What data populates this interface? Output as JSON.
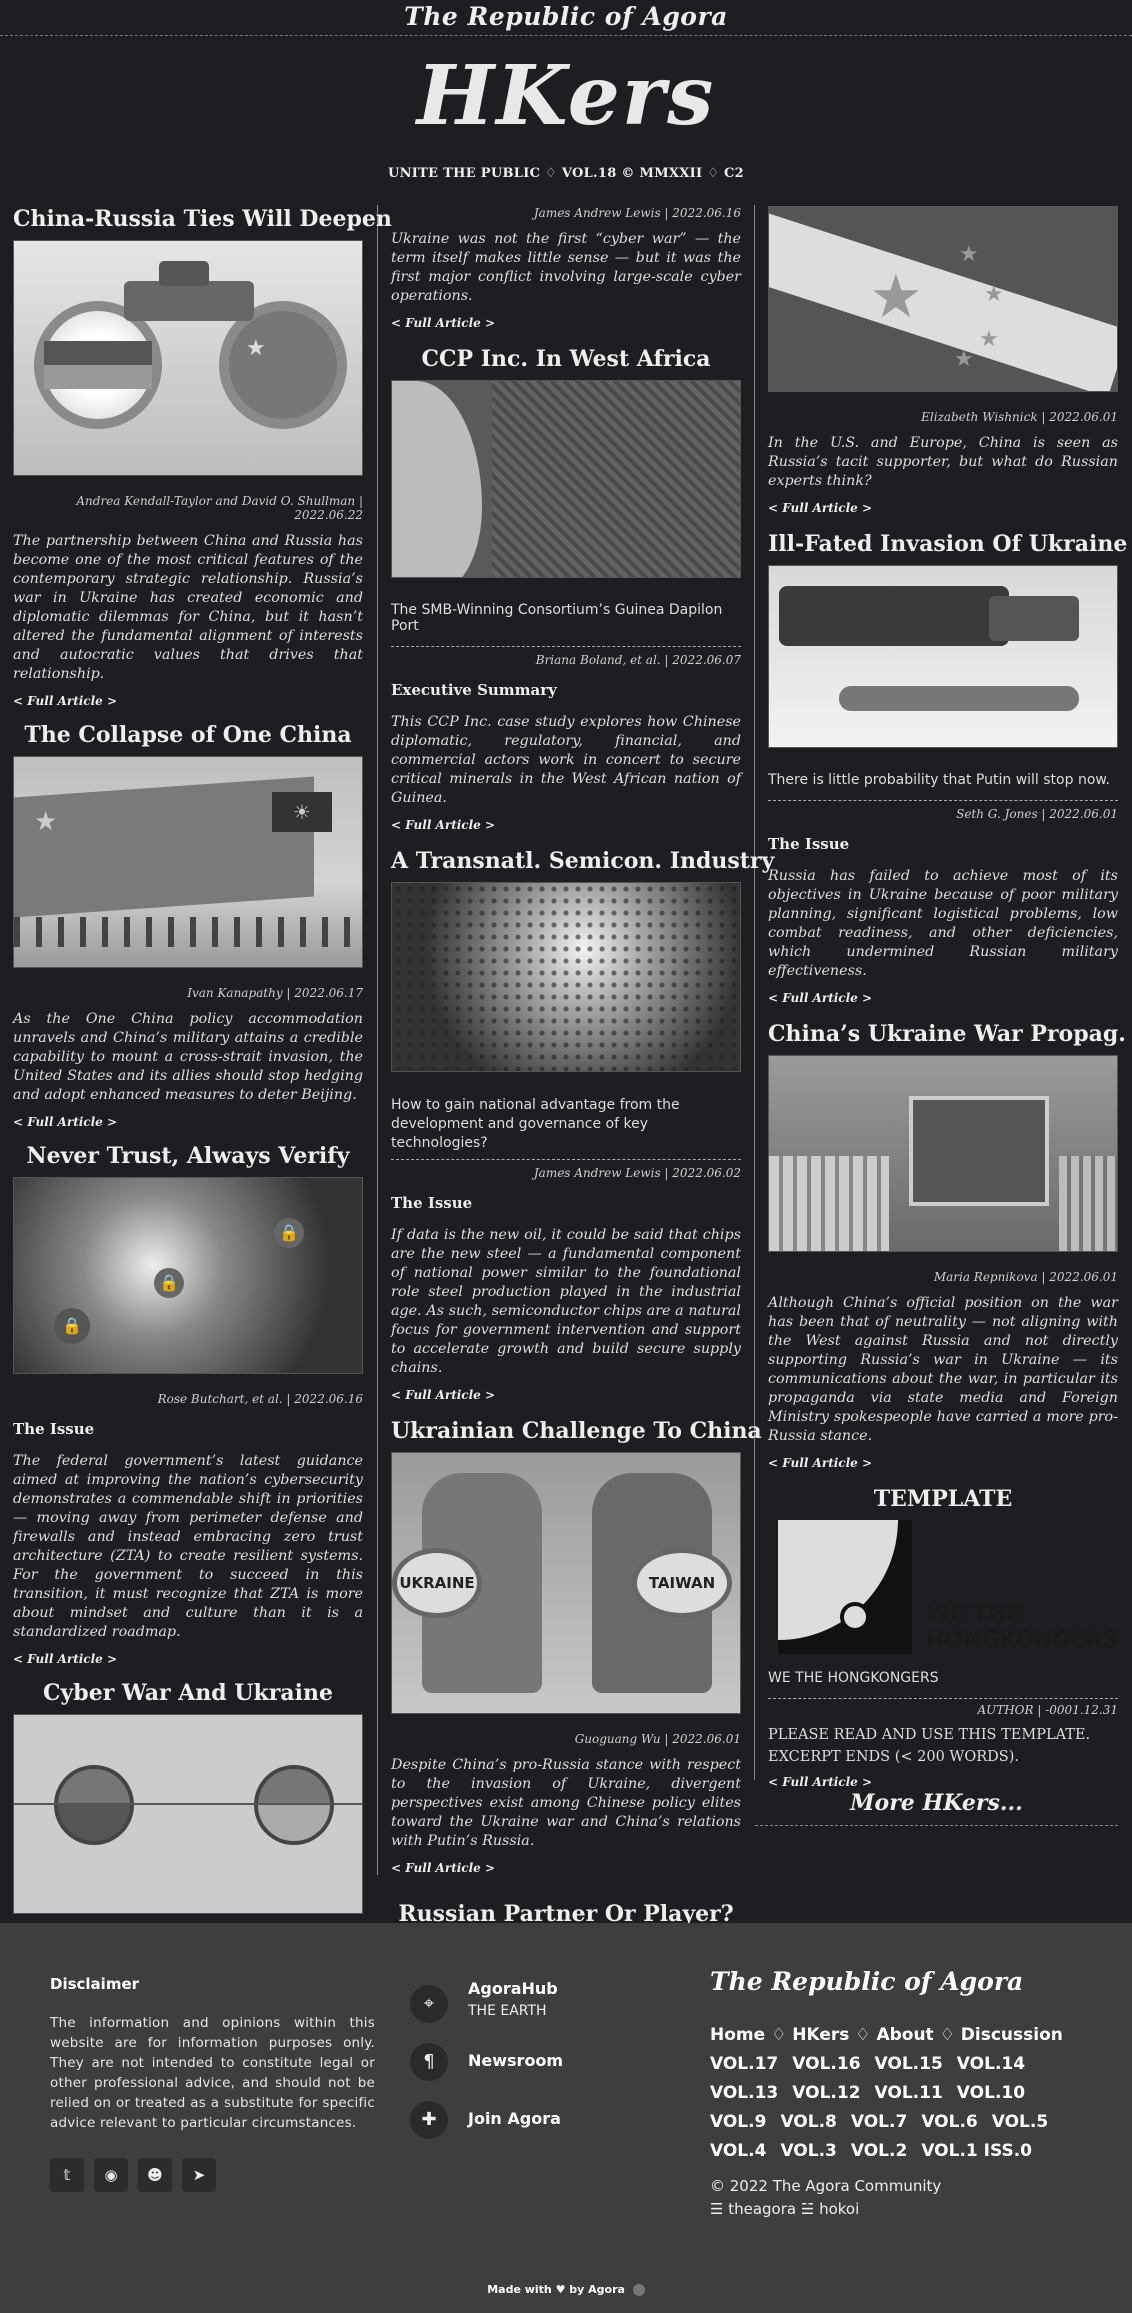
{
  "header": {
    "masthead": "The Republic of Agora",
    "logo": "HKers",
    "tagline": "UNITE THE PUBLIC ♢ VOL.18 © MMXXII ♢ C2"
  },
  "articles": {
    "a1": {
      "title": "China-Russia Ties Will Deepen",
      "byline": "Andrea Kendall-Taylor and David O. Shullman | 2022.06.22",
      "text": "The partnership between China and Russia has become one of the most critical features of the contemporary strategic relationship. Russia’s war in Ukraine has created economic and diplomatic dilemmas for China, but it hasn’t altered the fundamental alignment of interests and autocratic values that drives that relationship.",
      "more": "< Full Article >"
    },
    "a2": {
      "title": "The Collapse of One China",
      "byline": "Ivan Kanapathy | 2022.06.17",
      "text": "As the One China policy accommodation unravels and China’s military attains a credible capability to mount a cross-strait invasion, the United States and its allies should stop hedging and adopt enhanced measures to deter Beijing.",
      "more": "< Full Article >"
    },
    "a3": {
      "title": "Never Trust, Always Verify",
      "byline": "Rose Butchart, et al. | 2022.06.16",
      "issue": "The Issue",
      "text": "The federal government’s latest guidance aimed at improving the nation’s cybersecurity demonstrates a commendable shift in priorities — moving away from perimeter defense and firewalls and instead embracing zero trust architecture (ZTA) to create resilient systems. For the government to succeed in this transition, it must recognize that ZTA is more about mindset and culture than it is a standardized roadmap.",
      "more": "< Full Article >"
    },
    "a4": {
      "title": "Cyber War And Ukraine",
      "byline": "James Andrew Lewis | 2022.06.16",
      "text": "Ukraine was not the first “cyber war” — the term itself makes little sense — but it was the first major conflict involving large-scale cyber operations.",
      "more": "< Full Article >"
    },
    "a5": {
      "title": "CCP Inc. In West Africa",
      "subtitle": "The SMB-Winning Consortium’s Guinea Dapilon Port",
      "byline": "Briana Boland, et al. | 2022.06.07",
      "issue": "Executive Summary",
      "text": "This CCP Inc. case study explores how Chinese diplomatic, regulatory, financial, and commercial actors work in concert to secure critical minerals in the West African nation of Guinea.",
      "more": "< Full Article >"
    },
    "a6": {
      "title": "A Transnatl. Semicon. Industry",
      "subtitle": "How to gain national advantage from the development and governance of key technologies?",
      "byline": "James Andrew Lewis | 2022.06.02",
      "issue": "The Issue",
      "text": "If data is the new oil, it could be said that chips are the new steel — a fundamental component of national power similar to the foundational role steel production played in the industrial age. As such, semiconductor chips are a natural focus for government intervention and support to accelerate growth and build secure supply chains.",
      "more": "< Full Article >"
    },
    "a7": {
      "title": "Ukrainian Challenge To China",
      "byline": "Guoguang Wu | 2022.06.01",
      "text": "Despite China’s pro-Russia stance with respect to the invasion of Ukraine, divergent perspectives exist among Chinese policy elites toward the Ukraine war and China’s relations with Putin’s Russia.",
      "more": "< Full Article >",
      "img_left": "UKRAINE",
      "img_right": "TAIWAN"
    },
    "a8": {
      "title": "Russian Partner Or Player?",
      "byline": "Elizabeth Wishnick | 2022.06.01",
      "text": "In the U.S. and Europe, China is seen as Russia’s tacit supporter, but what do Russian experts think?",
      "more": "< Full Article >"
    },
    "a9": {
      "title": "Ill-Fated Invasion Of Ukraine",
      "subtitle": "There is little probability that Putin will stop now.",
      "byline": "Seth G. Jones | 2022.06.01",
      "issue": "The Issue",
      "text": "Russia has failed to achieve most of its objectives in Ukraine because of poor military planning, significant logistical problems, low combat readiness, and other deficiencies, which undermined Russian military effectiveness.",
      "more": "< Full Article >"
    },
    "a10": {
      "title": "China’s Ukraine War Propag.",
      "byline": "Maria Repnikova | 2022.06.01",
      "text": "Although China’s official position on the war has been that of neutrality — not aligning with the West against Russia and not directly supporting Russia’s war in Ukraine — its communications about the war, in particular its propaganda via state media and Foreign Ministry spokespeople have carried a more pro-Russia stance.",
      "more": "< Full Article >"
    },
    "a11": {
      "title": "TEMPLATE",
      "subtitle": "WE THE HONGKONGERS",
      "byline": "AUTHOR | -0001.12.31",
      "text1": "PLEASE READ AND USE THIS TEMPLATE.",
      "text2": "EXCERPT ENDS (< 200 WORDS).",
      "more": "< Full Article >",
      "logo_line1": "WE THE",
      "logo_line2": "HONGKONGERS"
    },
    "more_hkers": "More HKers..."
  },
  "footer": {
    "disclaimer_title": "Disclaimer",
    "disclaimer_text": "The information and opinions within this website are for information purposes only. They are not intended to constitute legal or other professional advice, and should not be relied on or treated as a substitute for specific advice relevant to particular circumstances.",
    "social": [
      "twitter-icon",
      "github-icon",
      "reddit-icon",
      "telegram-icon"
    ],
    "hub": {
      "title": "AgoraHub",
      "sub": "THE EARTH"
    },
    "newsroom": "Newsroom",
    "join": "Join Agora",
    "brand": "The Republic of Agora",
    "nav": [
      "Home",
      "HKers",
      "About",
      "Discussion"
    ],
    "vols": [
      "VOL.17",
      "VOL.16",
      "VOL.15",
      "VOL.14",
      "VOL.13",
      "VOL.12",
      "VOL.11",
      "VOL.10",
      "VOL.9",
      "VOL.8",
      "VOL.7",
      "VOL.6",
      "VOL.5",
      "VOL.4",
      "VOL.3",
      "VOL.2",
      "VOL.1 ISS.0"
    ],
    "copyright": "© 2022 The Agora Community",
    "handles": "☰ theagora ☱ hokoi",
    "made_with": "Made with ♥ by Agora"
  },
  "colors": {
    "bg": "#1d1e22",
    "footer": "#3e3e3e"
  }
}
